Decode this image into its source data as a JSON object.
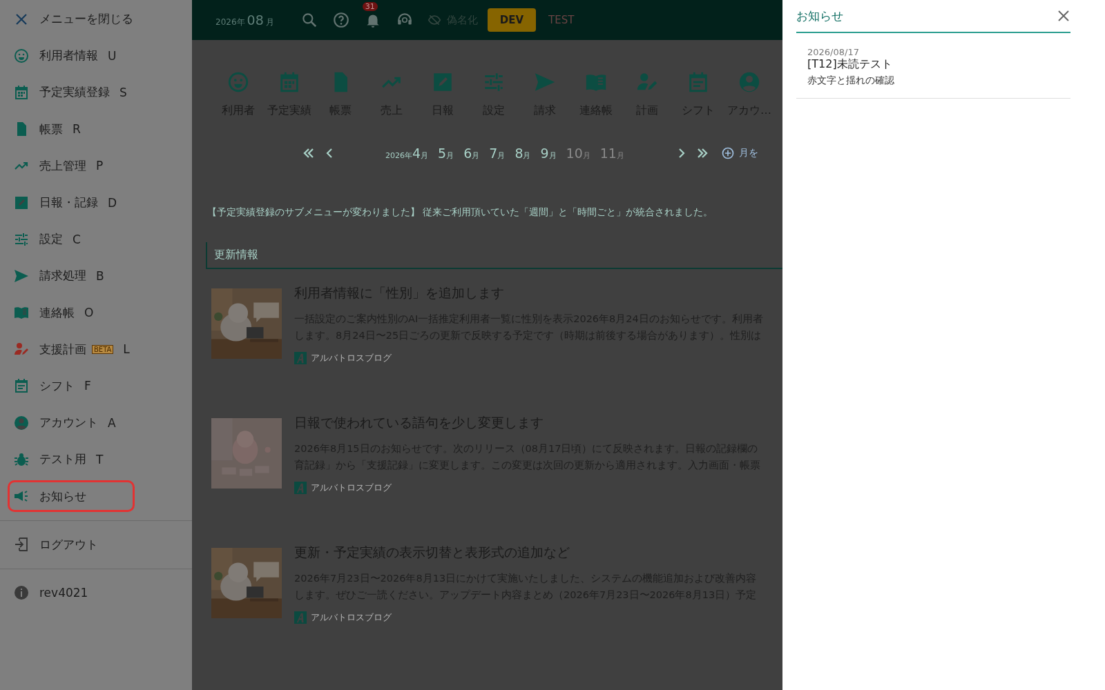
{
  "sidebar": {
    "close_label": "メニューを閉じる",
    "items": [
      {
        "label": "利用者情報",
        "key": "U",
        "color": "#0b5d50",
        "selected": false
      },
      {
        "label": "予定実績登録",
        "key": "S",
        "color": "#0b5d50",
        "selected": false
      },
      {
        "label": "帳票",
        "key": "R",
        "color": "#0b5d50",
        "selected": false
      },
      {
        "label": "売上管理",
        "key": "P",
        "color": "#0b5d50",
        "selected": false
      },
      {
        "label": "日報・記録",
        "key": "D",
        "color": "#0b5d50",
        "selected": false
      },
      {
        "label": "設定",
        "key": "C",
        "color": "#0b5d50",
        "selected": false
      },
      {
        "label": "請求処理",
        "key": "B",
        "color": "#0b5d50",
        "selected": false
      },
      {
        "label": "連絡帳",
        "key": "O",
        "color": "#0b5d50",
        "selected": false
      },
      {
        "label": "支援計画",
        "badge": "BETA",
        "key": "L",
        "color": "#9a2a22",
        "selected": false
      },
      {
        "label": "シフト",
        "key": "F",
        "color": "#0b5d50",
        "selected": false
      },
      {
        "label": "アカウント",
        "key": "A",
        "color": "#0b5d50",
        "selected": false
      },
      {
        "label": "テスト用",
        "key": "T",
        "color": "#0b5d50",
        "selected": false
      },
      {
        "label": "お知らせ",
        "color": "#0b5d50",
        "selected": true
      }
    ],
    "logout_label": "ログアウト",
    "version": "rev4021"
  },
  "header": {
    "year": "2026年",
    "month": "08",
    "month_unit": "月",
    "notification_count": "31",
    "pseudonym": {
      "label": "偽名化",
      "on": false
    },
    "environments": [
      {
        "label": "DEV",
        "selected": true
      },
      {
        "label": "TEST",
        "selected": false
      }
    ]
  },
  "shortcuts": [
    {
      "label": "利用者"
    },
    {
      "label": "予定実績"
    },
    {
      "label": "帳票"
    },
    {
      "label": "売上"
    },
    {
      "label": "日報"
    },
    {
      "label": "設定"
    },
    {
      "label": "請求"
    },
    {
      "label": "連絡帳"
    },
    {
      "label": "計画"
    },
    {
      "label": "シフト"
    },
    {
      "label": "アカウ…"
    }
  ],
  "month_nav": {
    "year": "2026年",
    "months": [
      {
        "number": "4",
        "unit": "月",
        "disabled": false
      },
      {
        "number": "5",
        "unit": "月",
        "disabled": false
      },
      {
        "number": "6",
        "unit": "月",
        "disabled": false
      },
      {
        "number": "7",
        "unit": "月",
        "disabled": false
      },
      {
        "number": "8",
        "unit": "月",
        "disabled": false
      },
      {
        "number": "9",
        "unit": "月",
        "disabled": false
      },
      {
        "number": "10",
        "unit": "月",
        "disabled": true
      },
      {
        "number": "11",
        "unit": "月",
        "disabled": true
      }
    ],
    "add_label": "月を"
  },
  "announcement": "【予定実績登録のサブメニューが変わりました】 従来ご利用頂いていた「週間」と「時間ごと」が統合されました。",
  "section_title": "更新情報",
  "articles": [
    {
      "title": "利用者情報に「性別」を追加します",
      "lines": [
        "一括設定のご案内性別のAI一括推定利用者一覧に性別を表示2026年8月24日のお知らせです。利用者",
        "します。8月24日〜25日ごろの更新で反映する予定です（時期は前後する場合があります）。性別は"
      ],
      "source": "アルバトロスブログ"
    },
    {
      "title": "日報で使われている語句を少し変更します",
      "lines": [
        "2026年8月15日のお知らせです。次のリリース（08月17日頃）にて反映されます。日報の記録欄の",
        "育記録」から「支援記録」に変更します。この変更は次回の更新から適用されます。入力画面・帳票"
      ],
      "source": "アルバトロスブログ"
    },
    {
      "title": "更新・予定実績の表示切替と表形式の追加など",
      "lines": [
        "2026年7月23日〜2026年8月13日にかけて実施いたしました、システムの機能追加および改善内容",
        "します。ぜひご一読ください。アップデート内容まとめ（2026年7月23日〜2026年8月13日）予定"
      ],
      "source": "アルバトロスブログ"
    }
  ],
  "panel": {
    "title": "お知らせ",
    "notices": [
      {
        "date": "2026/08/17",
        "title": "[T12]未読テスト",
        "body": "赤文字と揺れの確認"
      }
    ]
  }
}
